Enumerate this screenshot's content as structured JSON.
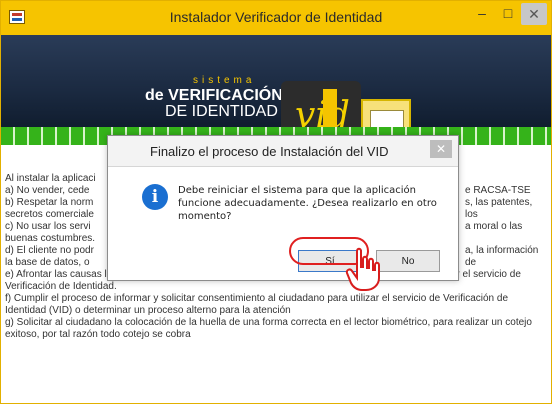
{
  "window": {
    "title": "Instalador Verificador de Identidad",
    "controls": {
      "minimize": "–",
      "maximize": "□",
      "close": "✕"
    }
  },
  "banner": {
    "sistema": "sistema",
    "line1": "de VERIFICACIÓN",
    "line2": "DE IDENTIDAD",
    "logo_text": "vid"
  },
  "content": {
    "lines": [
      "Al instalar la aplicaci",
      "a) No vender, cede",
      "b) Respetar la norm",
      "secretos comerciale",
      "c) No usar los servi",
      "buenas costumbres.",
      "d) El cliente no podr",
      "la base de datos, o"
    ],
    "right_fragments": {
      "a": "e RACSA-TSE",
      "b": "s, las patentes, los",
      "c": "a moral o las",
      "d": "a, la información de"
    },
    "paragraphs": {
      "e1": "e) Afrontar las causas legales que se presenten en su contra, por el mal uso de",
      "e2": "acción desplegada por el servicio de",
      "e3": "Verificación de Identidad.",
      "f": "f) Cumplir el proceso de informar y solicitar consentimiento al ciudadano para utilizar el servicio de Verificación de Identidad (VID) o determinar un proceso alterno para la atención",
      "g": "g) Solicitar al ciudadano la colocación de la huella de una forma correcta en el lector biométrico, para realizar un cotejo exitoso, por tal razón todo cotejo se cobra"
    }
  },
  "dialog": {
    "title": "Finalizo el proceso de Instalación del VID",
    "close": "✕",
    "message": "Debe reiniciar el sistema para que la aplicación funcione adecuadamente. ¿Desea realizarlo en otro momento?",
    "buttons": {
      "yes": "Sí",
      "no": "No"
    }
  },
  "colors": {
    "titlebar": "#f6c400",
    "banner": "#1b2a41",
    "green": "#35b31a",
    "highlight": "#e02020"
  },
  "icons": {
    "info": "info-icon",
    "cursor": "hand-pointer-icon"
  }
}
